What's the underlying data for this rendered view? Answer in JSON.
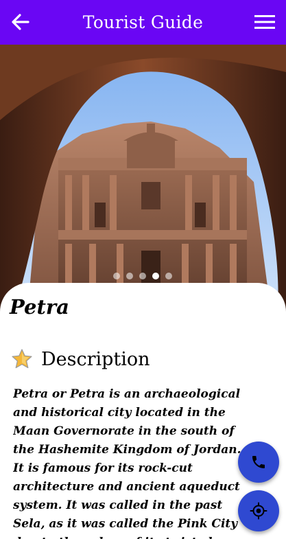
{
  "appbar": {
    "title": "Tourist Guide",
    "back_icon": "arrow-left-icon",
    "menu_icon": "hamburger-menu-icon",
    "color": "#6a06f4"
  },
  "carousel": {
    "image_description": "Petra treasury",
    "dot_count": 5,
    "active_index": 3
  },
  "place": {
    "name": "Petra"
  },
  "description": {
    "icon": "star-icon",
    "heading": "Description",
    "text": "Petra or Petra is an archaeological and historical city located in the Maan Governorate in the south of the Hashemite Kingdom of Jordan. It is famous for its rock-cut architecture and ancient aqueduct system. It was called in the past Sela, as it was called the Pink City due to the colors of its twisted rocks. Petra was founded"
  },
  "fabs": {
    "call_icon": "phone-icon",
    "location_icon": "gps-location-icon",
    "color": "#2f49d1"
  }
}
